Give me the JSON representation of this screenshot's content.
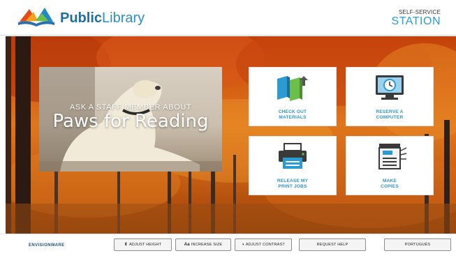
{
  "header": {
    "brand_bold": "Public",
    "brand_rest": "Library",
    "station_top": "SELF-SERVICE",
    "station_main": "STATION"
  },
  "promo": {
    "subtitle": "ASK A STAFF MEMBER ABOUT",
    "title": "Paws for Reading"
  },
  "tiles": [
    {
      "label_line1": "CHECK OUT",
      "label_line2": "MATERIALS",
      "icon": "books-icon"
    },
    {
      "label_line1": "RESERVE A",
      "label_line2": "COMPUTER",
      "icon": "computer-clock-icon"
    },
    {
      "label_line1": "RELEASE MY",
      "label_line2": "PRINT JOBS",
      "icon": "printer-icon"
    },
    {
      "label_line1": "MAKE",
      "label_line2": "COPIES",
      "icon": "copier-icon"
    }
  ],
  "footer": {
    "brand": "ENVISIONWARE",
    "adjust_height": "ADJUST HEIGHT",
    "increase_size_glyph": "Aa",
    "increase_size": "INCREASE SIZE",
    "adjust_contrast": "ADJUST CONTRAST",
    "request_help": "REQUEST HELP",
    "language": "PORTUGUÊS"
  },
  "colors": {
    "accent_blue": "#2b9bd3",
    "tile_label": "#2e93c6",
    "book_blue": "#2b9bd3",
    "book_green": "#6cc04a",
    "autumn_orange": "#e0761b"
  }
}
